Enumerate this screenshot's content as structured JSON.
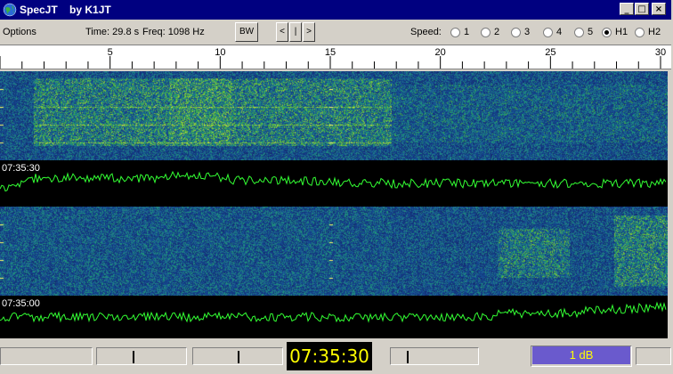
{
  "title": "SpecJT    by K1JT",
  "window_buttons": {
    "minimize": "_",
    "maximize": "□",
    "close": "×"
  },
  "toolbar": {
    "options_label": "Options",
    "time_label": "Time: 29.8 s",
    "freq_label": "Freq: 1098 Hz",
    "bw_label": "BW",
    "nav_prev": "<",
    "nav_mid": "|",
    "nav_next": ">",
    "speed_label": "Speed:",
    "speed_options": [
      "1",
      "2",
      "3",
      "4",
      "5",
      "H1",
      "H2"
    ],
    "speed_selected": "H1"
  },
  "ruler": {
    "ticks": [
      "5",
      "10",
      "15",
      "20",
      "25",
      "30"
    ]
  },
  "panels": {
    "upper_timestamp": "07:35:30",
    "lower_timestamp": "07:35:00"
  },
  "status": {
    "clock": "07:35:30",
    "gain": "1 dB"
  },
  "colors": {
    "waterfall_bg": "#1a3a7a",
    "signal": "#33ff33",
    "clock_text": "#ffff00",
    "gain_bg": "#6a5acd"
  }
}
